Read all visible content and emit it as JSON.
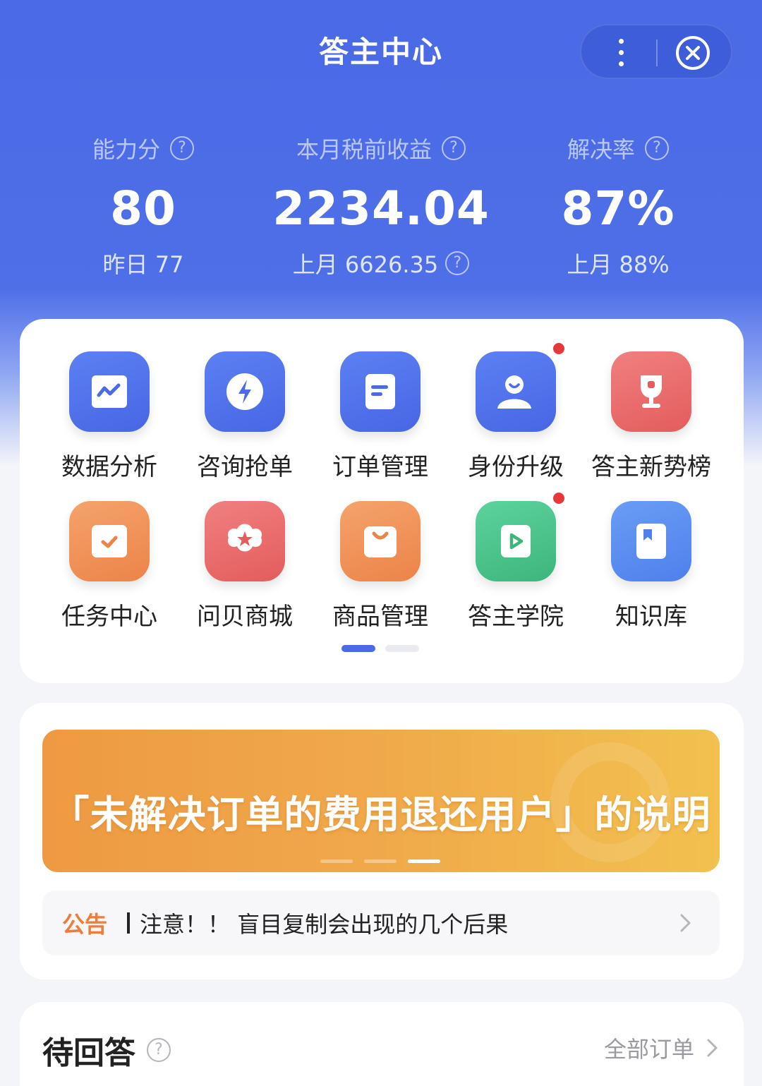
{
  "header": {
    "title": "答主中心",
    "more_icon": "more-vertical-icon",
    "close_icon": "close-circle-icon"
  },
  "stats": [
    {
      "label": "能力分",
      "value": "80",
      "sub": "昨日 77",
      "sub_help": false
    },
    {
      "label": "本月税前收益",
      "value": "2234.04",
      "sub": "上月 6626.35",
      "sub_help": true
    },
    {
      "label": "解决率",
      "value": "87%",
      "sub": "上月 88%",
      "sub_help": false
    }
  ],
  "help_glyph": "?",
  "grid": {
    "items": [
      {
        "label": "数据分析",
        "icon": "chart-icon",
        "color": "blue",
        "badge": false
      },
      {
        "label": "咨询抢单",
        "icon": "lightning-icon",
        "color": "blue",
        "badge": false
      },
      {
        "label": "订单管理",
        "icon": "document-icon",
        "color": "blue",
        "badge": false
      },
      {
        "label": "身份升级",
        "icon": "user-icon",
        "color": "blue",
        "badge": true
      },
      {
        "label": "答主新势榜",
        "icon": "trophy-icon",
        "color": "red",
        "badge": false
      },
      {
        "label": "任务中心",
        "icon": "task-check-icon",
        "color": "orange",
        "badge": false
      },
      {
        "label": "问贝商城",
        "icon": "store-star-icon",
        "color": "red",
        "badge": false
      },
      {
        "label": "商品管理",
        "icon": "shopping-bag-icon",
        "color": "orange",
        "badge": false
      },
      {
        "label": "答主学院",
        "icon": "play-video-icon",
        "color": "green",
        "badge": true
      },
      {
        "label": "知识库",
        "icon": "book-icon",
        "color": "bluelight",
        "badge": false
      }
    ],
    "page": 1,
    "pages": 2
  },
  "banner": {
    "text": "「未解决订单的费用退还用户」的说明",
    "slide": 3,
    "slides": 3
  },
  "notice": {
    "tag": "公告",
    "text": "注意！！ 盲目复制会出现的几个后果"
  },
  "pending": {
    "title": "待回答",
    "link": "全部订单"
  },
  "colors": {
    "primary": "#4a6ae6",
    "accent_orange": "#ee7d3a",
    "badge_red": "#e5383b"
  }
}
